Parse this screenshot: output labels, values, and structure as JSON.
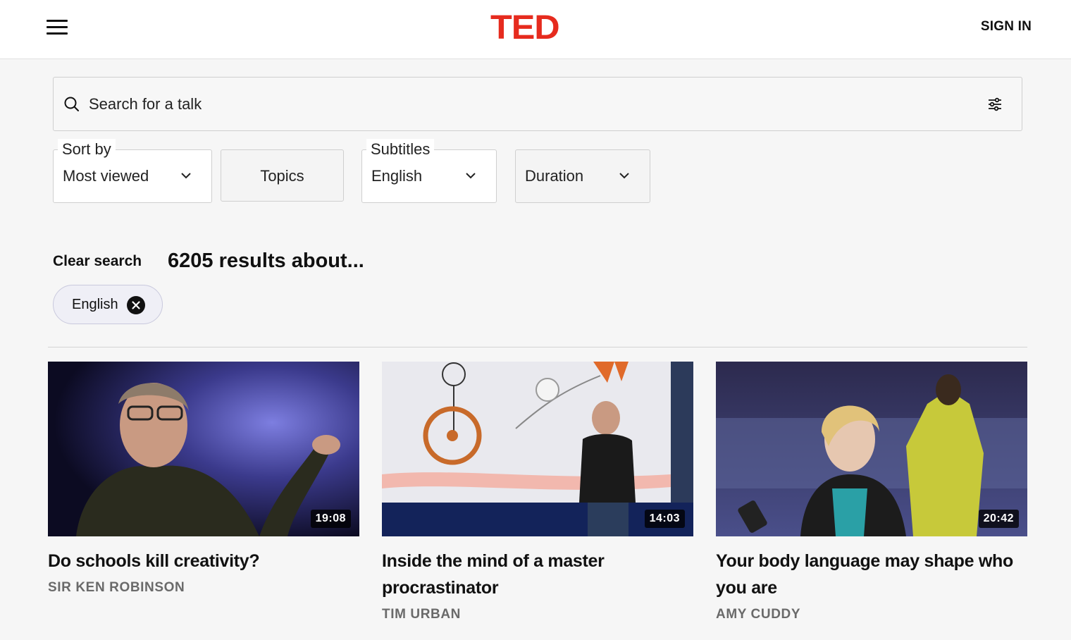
{
  "header": {
    "logo": "TED",
    "sign_in": "SIGN IN"
  },
  "search": {
    "placeholder": "Search for a talk"
  },
  "filters": {
    "sort": {
      "label": "Sort by",
      "value": "Most viewed"
    },
    "topics": {
      "label": "Topics"
    },
    "subtitles": {
      "label": "Subtitles",
      "value": "English"
    },
    "duration": {
      "label": "Duration"
    }
  },
  "results": {
    "clear_label": "Clear search",
    "count_text": "6205 results about..."
  },
  "active_filters": [
    {
      "label": "English"
    }
  ],
  "talks": [
    {
      "title": "Do schools kill creativity?",
      "speaker": "SIR KEN ROBINSON",
      "duration": "19:08"
    },
    {
      "title": "Inside the mind of a master procrastinator",
      "speaker": "TIM URBAN",
      "duration": "14:03"
    },
    {
      "title": "Your body language may shape who you are",
      "speaker": "AMY CUDDY",
      "duration": "20:42"
    }
  ],
  "colors": {
    "brand_red": "#e62b1e",
    "background": "#f6f6f6",
    "chip_bg": "#efeff6"
  },
  "icons": [
    "menu-icon",
    "search-icon",
    "filter-sliders-icon",
    "chevron-down-icon",
    "close-circle-icon"
  ]
}
